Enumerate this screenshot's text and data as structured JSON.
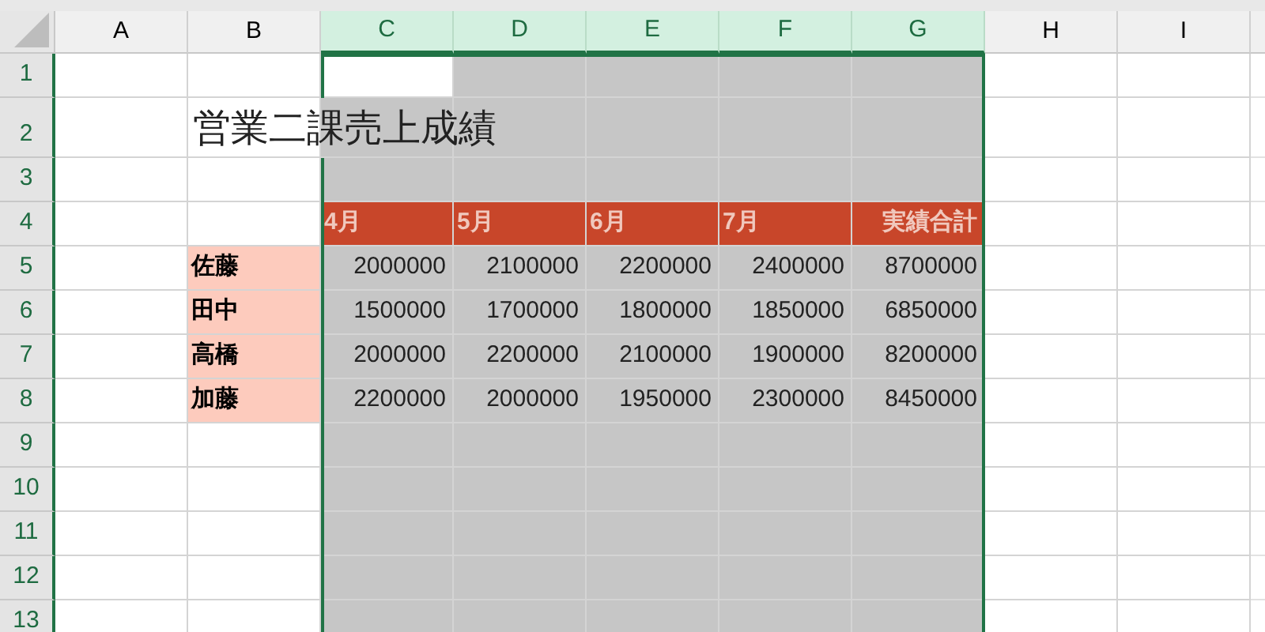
{
  "columns": [
    {
      "label": "A",
      "selected": false,
      "active": false
    },
    {
      "label": "B",
      "selected": false,
      "active": false
    },
    {
      "label": "C",
      "selected": true,
      "active": true
    },
    {
      "label": "D",
      "selected": true,
      "active": false
    },
    {
      "label": "E",
      "selected": true,
      "active": false
    },
    {
      "label": "F",
      "selected": true,
      "active": false
    },
    {
      "label": "G",
      "selected": true,
      "active": false
    },
    {
      "label": "H",
      "selected": false,
      "active": false
    },
    {
      "label": "I",
      "selected": false,
      "active": false
    }
  ],
  "rows": [
    {
      "label": "1",
      "selected": true,
      "active": true
    },
    {
      "label": "2",
      "selected": true,
      "active": false
    },
    {
      "label": "3",
      "selected": true,
      "active": false
    },
    {
      "label": "4",
      "selected": true,
      "active": false
    },
    {
      "label": "5",
      "selected": true,
      "active": false
    },
    {
      "label": "6",
      "selected": true,
      "active": false
    },
    {
      "label": "7",
      "selected": true,
      "active": false
    },
    {
      "label": "8",
      "selected": true,
      "active": false
    },
    {
      "label": "9",
      "selected": true,
      "active": false
    },
    {
      "label": "10",
      "selected": true,
      "active": false
    },
    {
      "label": "11",
      "selected": true,
      "active": false
    },
    {
      "label": "12",
      "selected": true,
      "active": false
    },
    {
      "label": "13",
      "selected": true,
      "active": false
    }
  ],
  "title": "営業二課売上成績",
  "table": {
    "headers": [
      "4月",
      "5月",
      "6月",
      "7月",
      "実績合計"
    ],
    "rows": [
      {
        "name": "佐藤",
        "values": [
          "2000000",
          "2100000",
          "2200000",
          "2400000",
          "8700000"
        ]
      },
      {
        "name": "田中",
        "values": [
          "1500000",
          "1700000",
          "1800000",
          "1850000",
          "6850000"
        ]
      },
      {
        "name": "高橋",
        "values": [
          "2000000",
          "2200000",
          "2100000",
          "1900000",
          "8200000"
        ]
      },
      {
        "name": "加藤",
        "values": [
          "2200000",
          "2000000",
          "1950000",
          "2300000",
          "8450000"
        ]
      }
    ]
  }
}
